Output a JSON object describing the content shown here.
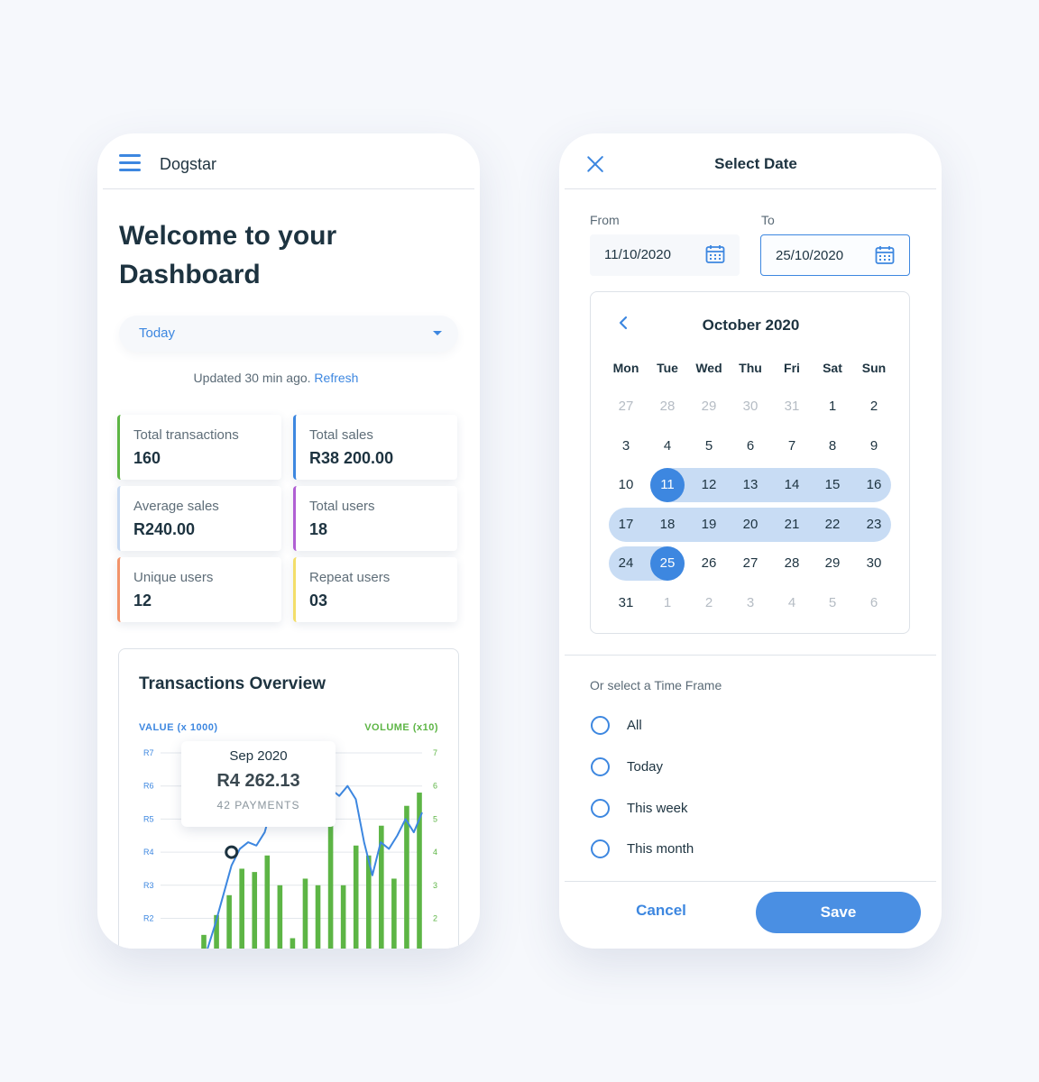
{
  "dashboard": {
    "app_title": "Dogstar",
    "welcome": "Welcome to your Dashboard",
    "period": {
      "selected": "Today"
    },
    "updated_text": "Updated 30 min ago.",
    "refresh_label": "Refresh",
    "stats": [
      {
        "label": "Total transactions",
        "value": "160",
        "color": "#5db545"
      },
      {
        "label": "Total sales",
        "value": "R38 200.00",
        "color": "#3d87e0"
      },
      {
        "label": "Average sales",
        "value": "R240.00",
        "color": "#c6d9f2"
      },
      {
        "label": "Total users",
        "value": "18",
        "color": "#b05fd3"
      },
      {
        "label": "Unique users",
        "value": "12",
        "color": "#f2936a"
      },
      {
        "label": "Repeat users",
        "value": "03",
        "color": "#f3de6a"
      }
    ],
    "overview_title": "Transactions Overview",
    "tooltip": {
      "date": "Sep 2020",
      "amount": "R4 262.13",
      "payments": "42 PAYMENTS"
    }
  },
  "chart_data": {
    "type": "bar",
    "title": "Transactions Overview",
    "ylabel_left": "VALUE (x 1000)",
    "ylabel_right": "VOLUME (x10)",
    "left_ticks": [
      "R7",
      "R6",
      "R5",
      "R4",
      "R3",
      "R2"
    ],
    "right_ticks": [
      "7",
      "6",
      "5",
      "4",
      "3",
      "2"
    ],
    "ylim": [
      1,
      7
    ],
    "grid": true,
    "series": [
      {
        "name": "VOLUME (x10)",
        "type": "bar",
        "color": "#5db545",
        "values": [
          1.5,
          2.1,
          2.7,
          3.5,
          3.4,
          3.9,
          3.0,
          1.4,
          3.2,
          3.0,
          4.8,
          3.0,
          4.2,
          3.9,
          4.8,
          3.2,
          5.4,
          5.8
        ]
      },
      {
        "name": "VALUE (x 1000)",
        "type": "line",
        "color": "#3d87e0",
        "x": [
          0,
          1,
          2,
          3,
          4,
          5,
          6,
          7,
          8,
          9,
          10,
          11,
          12,
          13,
          14,
          15,
          16,
          17,
          18,
          19,
          20,
          21,
          22,
          23,
          24,
          25,
          26,
          27
        ],
        "values": [
          0.4,
          1.0,
          1.8,
          2.7,
          3.6,
          4.1,
          4.3,
          4.2,
          4.6,
          5.5,
          5.8,
          6.1,
          6.3,
          6.0,
          6.2,
          6.4,
          5.9,
          5.7,
          6.0,
          5.6,
          4.3,
          3.3,
          4.3,
          4.1,
          4.5,
          5.0,
          4.6,
          5.2
        ]
      }
    ],
    "highlight": {
      "series": "VALUE (x 1000)",
      "x": 4,
      "value": 4.0
    }
  },
  "date_picker": {
    "title": "Select Date",
    "from_label": "From",
    "from_value": "11/10/2020",
    "to_label": "To",
    "to_value": "25/10/2020",
    "month": "October 2020",
    "weekdays": [
      "Mon",
      "Tue",
      "Wed",
      "Thu",
      "Fri",
      "Sat",
      "Sun"
    ],
    "weeks": [
      [
        "27",
        "28",
        "29",
        "30",
        "31",
        "1",
        "2"
      ],
      [
        "3",
        "4",
        "5",
        "6",
        "7",
        "8",
        "9"
      ],
      [
        "10",
        "11",
        "12",
        "13",
        "14",
        "15",
        "16"
      ],
      [
        "17",
        "18",
        "19",
        "20",
        "21",
        "22",
        "23"
      ],
      [
        "24",
        "25",
        "26",
        "27",
        "28",
        "29",
        "30"
      ],
      [
        "31",
        "1",
        "2",
        "3",
        "4",
        "5",
        "6"
      ]
    ],
    "range_start": "11",
    "range_end": "25",
    "timeframe_label": "Or select a Time Frame",
    "timeframes": [
      "All",
      "Today",
      "This week",
      "This month"
    ],
    "cancel_label": "Cancel",
    "save_label": "Save"
  },
  "colors": {
    "accent": "#3d87e0",
    "range": "#c8dcf4",
    "bars": "#5db545",
    "text": "#1d3340"
  }
}
